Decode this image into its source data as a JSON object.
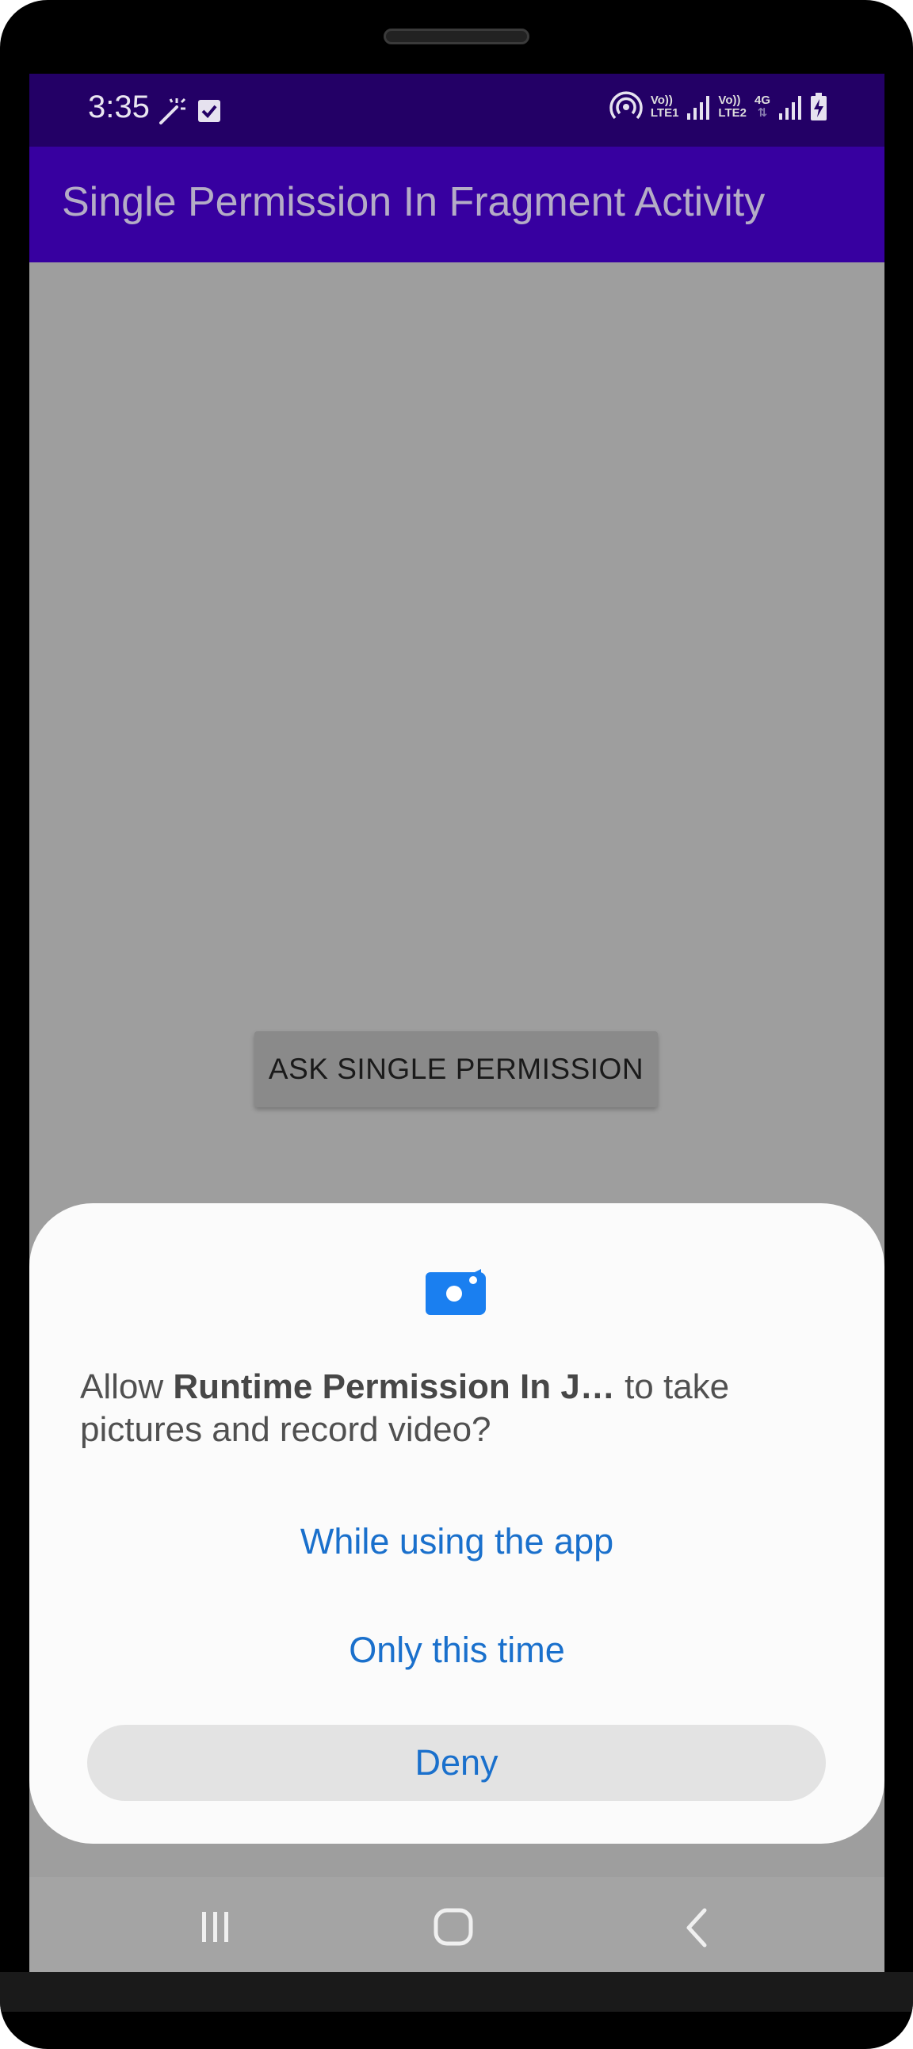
{
  "status_bar": {
    "time": "3:35",
    "left_icons": [
      "magic-wand-icon",
      "checkbox-icon"
    ],
    "right_icons": [
      "hotspot-icon",
      "signal-sim1-icon",
      "signal-sim2-icon",
      "battery-charging-icon"
    ],
    "sim1_label_top": "Vo))",
    "sim1_label_bottom": "LTE1",
    "sim2_label_top": "Vo))",
    "sim2_label_bottom": "LTE2",
    "network_type": "4G"
  },
  "app_bar": {
    "title": "Single Permission In Fragment Activity"
  },
  "main": {
    "ask_button_label": "ASK SINGLE PERMISSION"
  },
  "dialog": {
    "icon": "camera-icon",
    "message_prefix": "Allow ",
    "message_app": "Runtime Permission In J…",
    "message_suffix": " to take pictures and record video?",
    "options": [
      {
        "label": "While using the app"
      },
      {
        "label": "Only this time"
      },
      {
        "label": "Deny"
      }
    ]
  },
  "nav_bar": {
    "items": [
      "recent-apps-icon",
      "home-icon",
      "back-icon"
    ]
  },
  "colors": {
    "status_bar": "#230066",
    "app_bar": "#3700a0",
    "dialog_accent": "#1a70cc",
    "scrim": "#9e9e9e"
  }
}
